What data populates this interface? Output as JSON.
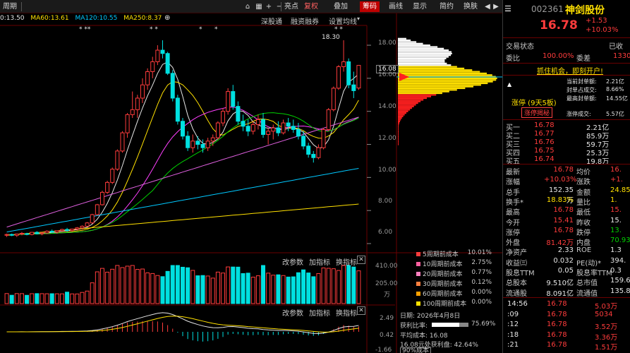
{
  "topbar": {
    "period_label": "周期",
    "buttons": [
      "亮点",
      "复权",
      "叠加",
      "筹码",
      "画线",
      "显示",
      "简约",
      "换肤"
    ],
    "active_button": "筹码",
    "tabs": [
      "深股通",
      "融资融券",
      "设置均线"
    ]
  },
  "ma_legend": [
    {
      "label": "0:13.50",
      "color": "#e6e6e6"
    },
    {
      "label": "MA60:13.61",
      "color": "#ffe000"
    },
    {
      "label": "MA120:10.55",
      "color": "#00c8ff"
    },
    {
      "label": "MA250:8.37",
      "color": "#ffe000"
    }
  ],
  "stars_top": [
    "* **",
    "* *",
    "*",
    "*",
    "* *"
  ],
  "high_label": "18.30",
  "y_axis_labels": [
    "18.00",
    "16.08",
    "16.00",
    "14.00",
    "12.00",
    "10.00",
    "8.00",
    "6.00"
  ],
  "current_price_tag": "16.08",
  "volume_axis_labels": [
    "410.00",
    "205.00",
    "万"
  ],
  "macd_axis_labels": [
    "2.49",
    "0.42",
    "-1.66"
  ],
  "volume_toolbar": [
    "改参数",
    "加指标",
    "换指标"
  ],
  "macd_toolbar": [
    "改参数",
    "加指标",
    "换指标"
  ],
  "cost_legend": [
    {
      "label": "5周期前成本",
      "pct": "10.01%",
      "color": "#ff3c3c"
    },
    {
      "label": "10周期前成本",
      "pct": "2.75%",
      "color": "#ff60a0"
    },
    {
      "label": "20周期前成本",
      "pct": "0.77%",
      "color": "#ff80c0"
    },
    {
      "label": "30周期前成本",
      "pct": "0.12%",
      "color": "#ff8040"
    },
    {
      "label": "60周期前成本",
      "pct": "0.00%",
      "color": "#ffa000"
    },
    {
      "label": "100周期前成本",
      "pct": "0.00%",
      "color": "#ffe000"
    }
  ],
  "chip_info": {
    "date": "日期: 2026年4月8日",
    "profit_ratio_label": "获利比率:",
    "profit_ratio": "75.69%",
    "avg_cost": "平均成本: 16.08",
    "profit_line": "16.08元处获利盘: 42.64%",
    "cost_label": "90%成本"
  },
  "stock": {
    "code": "002361",
    "name": "神剑股份",
    "price": "16.78",
    "change": "+1.53",
    "change_pct": "+10.03%",
    "status_label": "交易状态",
    "status_value": "已收",
    "weibi_label": "委比",
    "weibi_value": "100.00%",
    "weicha_label": "委差",
    "weicha_value": "1330",
    "promo": "抓住机会，即刻开户!",
    "limit_title": "涨停 (9天5板)",
    "limit_button": "涨停揭秘",
    "limit_stats": [
      {
        "label": "当前封单额:",
        "value": "2.21亿"
      },
      {
        "label": "封单占成交:",
        "value": "8.66%"
      },
      {
        "label": "最高封单额:",
        "value": "14.55亿"
      },
      {
        "label": "涨停成交:",
        "value": "5.57亿"
      }
    ]
  },
  "order_book": [
    {
      "label": "买一",
      "price": "16.78",
      "vol": "2.21亿"
    },
    {
      "label": "买二",
      "price": "16.77",
      "vol": "85.9万"
    },
    {
      "label": "买三",
      "price": "16.76",
      "vol": "59.7万"
    },
    {
      "label": "买四",
      "price": "16.75",
      "vol": "25.3万"
    },
    {
      "label": "买五",
      "price": "16.74",
      "vol": "19.8万"
    }
  ],
  "quote_rows": [
    {
      "l1": "最新",
      "v1": "16.78",
      "c1": "red",
      "l2": "均价",
      "v2": "16.",
      "c2": "red"
    },
    {
      "l1": "涨幅",
      "v1": "+10.03%",
      "c1": "red",
      "l2": "涨跌",
      "v2": "+1.",
      "c2": "red"
    },
    {
      "l1": "总手",
      "v1": "152.35万",
      "c1": "white",
      "l2": "金额",
      "v2": "24.85",
      "c2": "yellow"
    },
    {
      "l1": "换手*",
      "v1": "18.83%",
      "c1": "yellow",
      "l2": "量比",
      "v2": "1.",
      "c2": "yellow"
    },
    {
      "l1": "最高",
      "v1": "16.78",
      "c1": "red",
      "l2": "最低",
      "v2": "15.",
      "c2": "red"
    },
    {
      "l1": "今开",
      "v1": "15.41",
      "c1": "red",
      "l2": "昨收",
      "v2": "15.",
      "c2": "white"
    },
    {
      "l1": "涨停",
      "v1": "16.78",
      "c1": "red",
      "l2": "跌停",
      "v2": "13.",
      "c2": "green"
    },
    {
      "l1": "外盘",
      "v1": "81.42万",
      "c1": "red",
      "l2": "内盘",
      "v2": "70.93",
      "c2": "green"
    },
    {
      "l1": "净资产",
      "v1": "2.33",
      "c1": "white",
      "l2": "ROE",
      "v2": "1.3",
      "c2": "white"
    },
    {
      "l1": "收益㈢",
      "v1": "0.032",
      "c1": "white",
      "l2": "PE(动)*",
      "v2": "394.",
      "c2": "white"
    },
    {
      "l1": "股息TTM",
      "v1": "0.05",
      "c1": "white",
      "l2": "股息率TTM",
      "v2": "0.3",
      "c2": "white"
    },
    {
      "l1": "总股本",
      "v1": "9.510亿",
      "c1": "white",
      "l2": "总市值",
      "v2": "159.6",
      "c2": "white"
    },
    {
      "l1": "流通股",
      "v1": "8.091亿",
      "c1": "white",
      "l2": "流通值",
      "v2": "135.8",
      "c2": "white"
    }
  ],
  "ticks": [
    {
      "time": "14:56",
      "price": "16.78",
      "vol": "5.03万"
    },
    {
      "time": ":09",
      "price": "16.78",
      "vol": "5034"
    },
    {
      "time": ":12",
      "price": "16.78",
      "vol": "3.52万"
    },
    {
      "time": ":18",
      "price": "16.78",
      "vol": "3.36万"
    },
    {
      "time": ":21",
      "price": "16.78",
      "vol": "1.51万"
    }
  ],
  "chart_data": {
    "type": "candlestick",
    "price_range": [
      6.0,
      18.6
    ],
    "candles": [
      [
        6.5,
        6.6,
        6.4,
        6.55
      ],
      [
        6.55,
        6.6,
        6.45,
        6.5
      ],
      [
        6.5,
        6.6,
        6.4,
        6.58
      ],
      [
        6.58,
        6.7,
        6.5,
        6.62
      ],
      [
        6.6,
        6.65,
        6.5,
        6.55
      ],
      [
        6.55,
        6.7,
        6.5,
        6.68
      ],
      [
        6.68,
        6.75,
        6.55,
        6.6
      ],
      [
        6.6,
        6.7,
        6.5,
        6.65
      ],
      [
        6.65,
        6.8,
        6.6,
        6.75
      ],
      [
        6.75,
        6.85,
        6.65,
        6.7
      ],
      [
        6.7,
        6.8,
        6.6,
        6.78
      ],
      [
        6.78,
        6.9,
        6.7,
        6.85
      ],
      [
        6.85,
        6.95,
        6.7,
        6.8
      ],
      [
        6.8,
        6.9,
        6.7,
        6.88
      ],
      [
        6.88,
        7.0,
        6.8,
        6.95
      ],
      [
        6.95,
        7.1,
        6.85,
        7.05
      ],
      [
        7.05,
        7.3,
        7.0,
        7.25
      ],
      [
        7.25,
        7.8,
        7.2,
        7.75
      ],
      [
        7.75,
        8.4,
        7.7,
        8.35
      ],
      [
        8.35,
        9.2,
        8.3,
        9.1
      ],
      [
        9.1,
        9.8,
        9.0,
        9.7
      ],
      [
        9.7,
        10.6,
        9.6,
        10.5
      ],
      [
        10.5,
        11.7,
        10.4,
        11.6
      ],
      [
        11.6,
        12.8,
        11.5,
        12.7
      ],
      [
        12.7,
        13.9,
        12.4,
        13.8
      ],
      [
        13.8,
        15.2,
        13.6,
        14.1
      ],
      [
        14.1,
        15.0,
        13.6,
        14.8
      ],
      [
        14.8,
        16.0,
        14.5,
        15.6
      ],
      [
        15.6,
        16.6,
        15.3,
        16.4
      ],
      [
        16.4,
        17.3,
        16.0,
        17.0
      ],
      [
        17.0,
        18.0,
        16.8,
        17.7
      ],
      [
        17.7,
        18.3,
        17.2,
        17.5
      ],
      [
        17.5,
        17.6,
        16.2,
        16.3
      ],
      [
        16.3,
        16.5,
        14.6,
        14.8
      ],
      [
        14.8,
        15.0,
        13.2,
        13.4
      ],
      [
        13.4,
        13.6,
        12.3,
        12.5
      ],
      [
        12.5,
        12.8,
        11.6,
        11.8
      ],
      [
        11.8,
        12.6,
        11.5,
        12.2
      ],
      [
        12.2,
        12.5,
        11.7,
        12.0
      ],
      [
        12.0,
        12.3,
        11.5,
        11.8
      ],
      [
        11.8,
        12.4,
        11.6,
        12.2
      ],
      [
        12.2,
        12.6,
        11.9,
        12.4
      ],
      [
        12.4,
        13.4,
        12.3,
        13.3
      ],
      [
        13.3,
        14.2,
        13.1,
        14.0
      ],
      [
        14.0,
        15.4,
        13.8,
        15.2
      ],
      [
        15.2,
        15.6,
        14.1,
        14.3
      ],
      [
        14.3,
        14.6,
        13.2,
        13.4
      ],
      [
        13.4,
        13.8,
        12.8,
        13.1
      ],
      [
        13.1,
        13.5,
        12.5,
        12.8
      ],
      [
        12.8,
        13.4,
        12.6,
        13.2
      ],
      [
        13.2,
        13.8,
        12.9,
        13.5
      ],
      [
        13.5,
        13.9,
        12.4,
        12.6
      ],
      [
        12.6,
        13.0,
        12.0,
        12.8
      ],
      [
        12.8,
        13.2,
        12.3,
        13.0
      ],
      [
        13.0,
        13.4,
        12.5,
        12.7
      ],
      [
        12.7,
        13.5,
        12.6,
        13.3
      ],
      [
        13.3,
        13.6,
        12.8,
        13.1
      ],
      [
        13.1,
        13.5,
        12.7,
        12.9
      ],
      [
        12.9,
        13.3,
        12.3,
        12.5
      ],
      [
        12.5,
        12.8,
        11.7,
        11.9
      ],
      [
        11.9,
        12.1,
        11.2,
        11.4
      ],
      [
        11.4,
        11.6,
        10.9,
        11.2
      ],
      [
        11.2,
        12.0,
        11.1,
        11.8
      ],
      [
        11.8,
        13.0,
        11.7,
        12.9
      ],
      [
        12.9,
        14.2,
        12.8,
        14.1
      ],
      [
        14.1,
        15.5,
        14.0,
        15.4
      ],
      [
        15.4,
        16.8,
        15.3,
        16.7
      ],
      [
        16.7,
        18.3,
        16.4,
        17.0
      ],
      [
        17.0,
        17.2,
        15.4,
        15.6
      ],
      [
        15.6,
        16.4,
        14.8,
        15.25
      ],
      [
        15.41,
        16.78,
        15.3,
        16.78
      ]
    ]
  }
}
